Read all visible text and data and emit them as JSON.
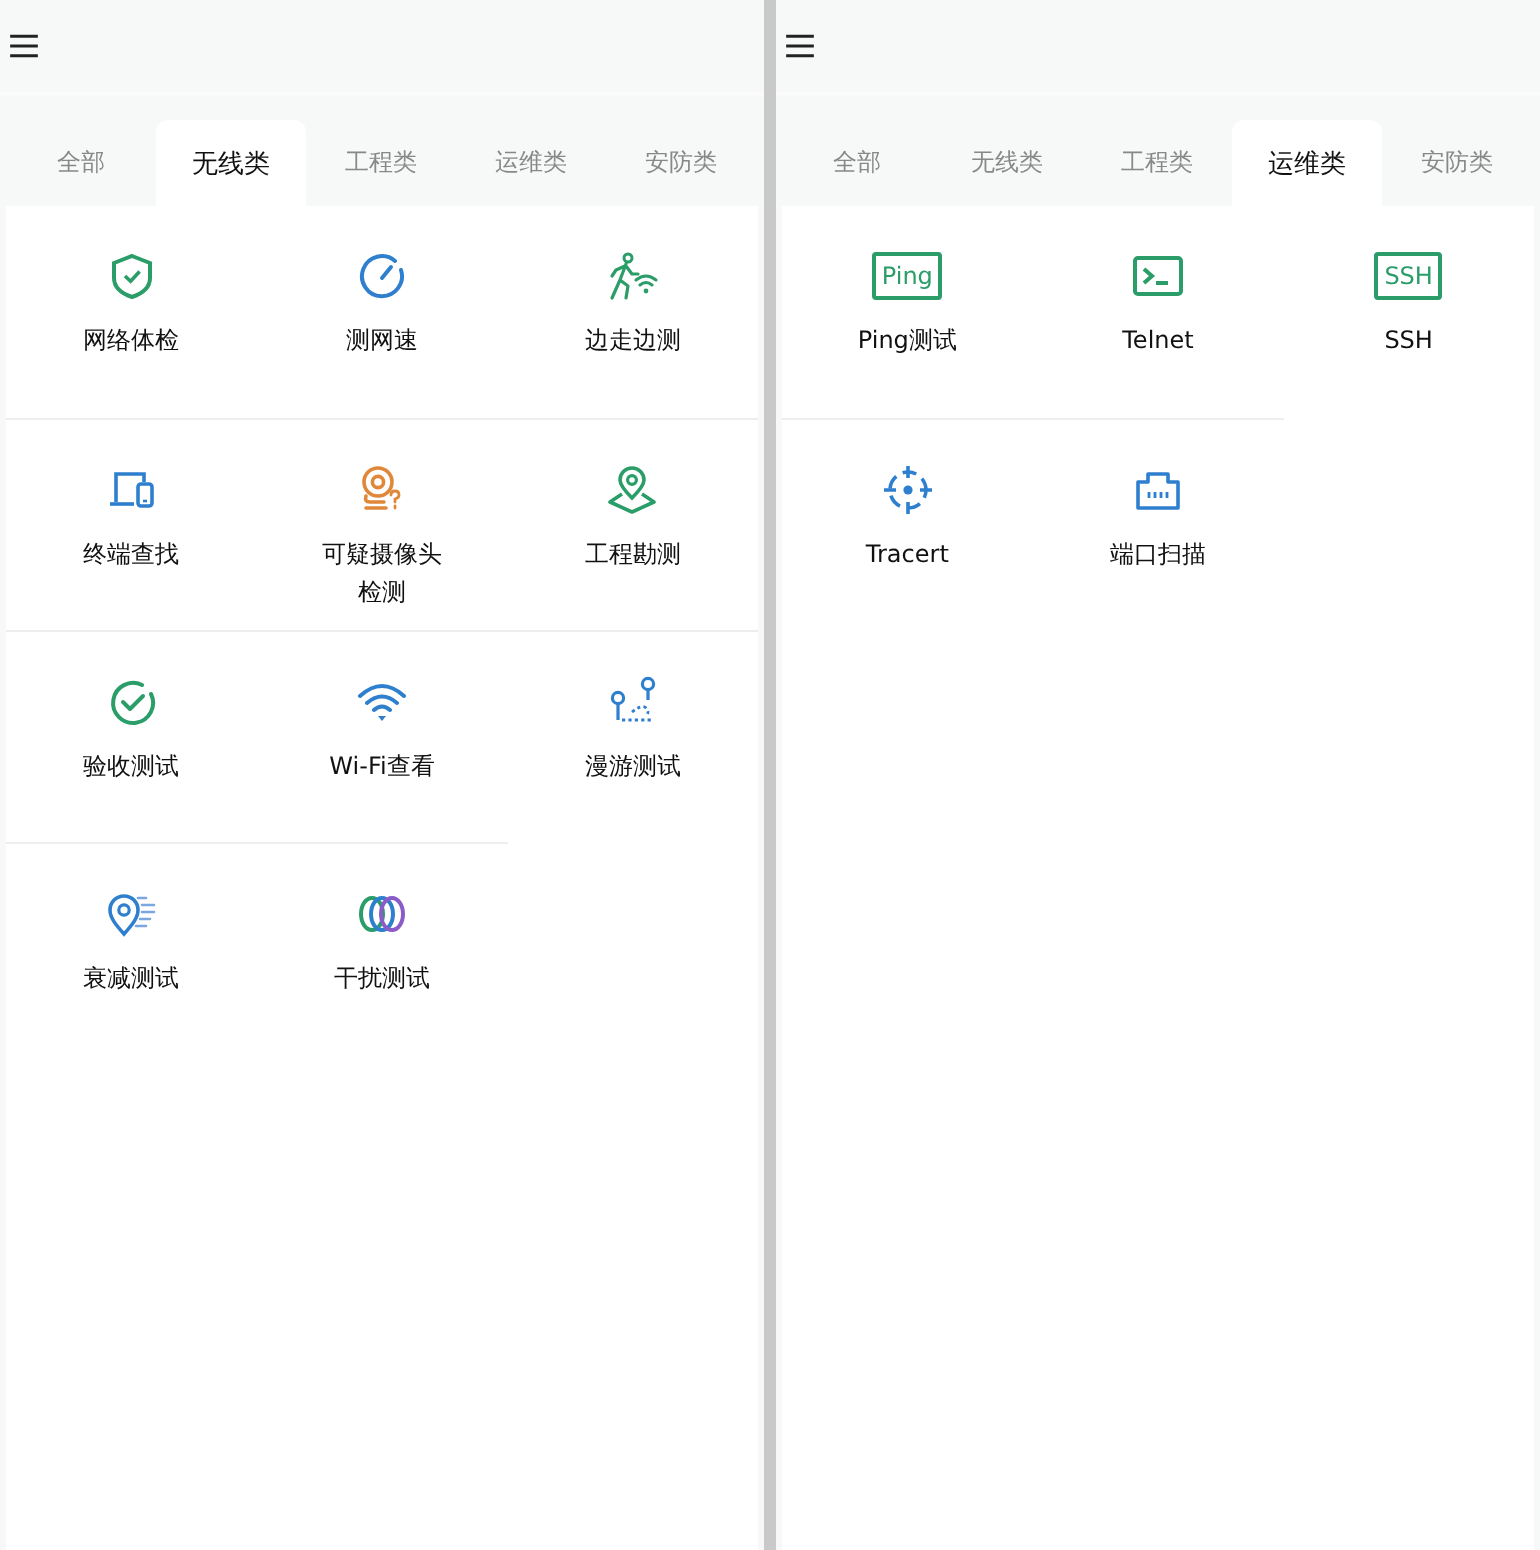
{
  "screens": [
    {
      "tabs": [
        {
          "label": "全部",
          "selected": false
        },
        {
          "label": "无线类",
          "selected": true
        },
        {
          "label": "工程类",
          "selected": false
        },
        {
          "label": "运维类",
          "selected": false
        },
        {
          "label": "安防类",
          "selected": false
        }
      ],
      "tools": [
        {
          "label": "网络体检",
          "kind": "shield"
        },
        {
          "label": "测网速",
          "kind": "gauge"
        },
        {
          "label": "边走边测",
          "kind": "walker"
        },
        {
          "label": "终端查找",
          "kind": "devices"
        },
        {
          "label": "可疑摄像头检测",
          "kind": "camera"
        },
        {
          "label": "工程勘测",
          "kind": "survey"
        },
        {
          "label": "验收测试",
          "kind": "check"
        },
        {
          "label": "Wi-Fi查看",
          "kind": "wifi"
        },
        {
          "label": "漫游测试",
          "kind": "route"
        },
        {
          "label": "衰减测试",
          "kind": "signal"
        },
        {
          "label": "干扰测试",
          "kind": "rings"
        }
      ]
    },
    {
      "tabs": [
        {
          "label": "全部",
          "selected": false
        },
        {
          "label": "无线类",
          "selected": false
        },
        {
          "label": "工程类",
          "selected": false
        },
        {
          "label": "运维类",
          "selected": true
        },
        {
          "label": "安防类",
          "selected": false
        }
      ],
      "tools": [
        {
          "label": "Ping测试",
          "kind": "textbox",
          "icon_text": "Ping"
        },
        {
          "label": "Telnet",
          "kind": "terminal"
        },
        {
          "label": "SSH",
          "kind": "textbox",
          "icon_text": "SSH"
        },
        {
          "label": "Tracert",
          "kind": "target"
        },
        {
          "label": "端口扫描",
          "kind": "port"
        }
      ]
    }
  ]
}
